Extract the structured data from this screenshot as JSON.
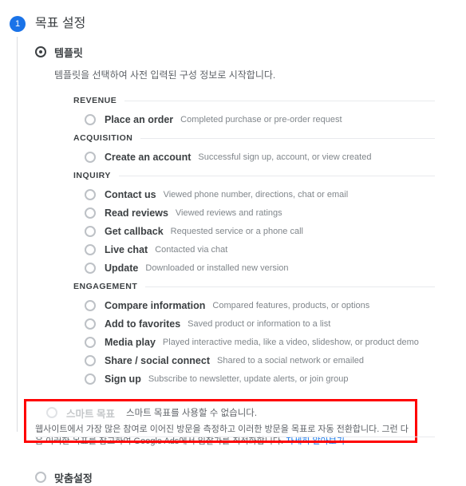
{
  "step": {
    "number": "1",
    "title": "목표 설정"
  },
  "template_option": {
    "label": "템플릿",
    "helper": "템플릿을 선택하여 사전 입력된 구성 정보로 시작합니다."
  },
  "groups": [
    {
      "name": "REVENUE",
      "options": [
        {
          "label": "Place an order",
          "description": "Completed purchase or pre-order request"
        }
      ]
    },
    {
      "name": "ACQUISITION",
      "options": [
        {
          "label": "Create an account",
          "description": "Successful sign up, account, or view created"
        }
      ]
    },
    {
      "name": "INQUIRY",
      "options": [
        {
          "label": "Contact us",
          "description": "Viewed phone number, directions, chat or email"
        },
        {
          "label": "Read reviews",
          "description": "Viewed reviews and ratings"
        },
        {
          "label": "Get callback",
          "description": "Requested service or a phone call"
        },
        {
          "label": "Live chat",
          "description": "Contacted via chat"
        },
        {
          "label": "Update",
          "description": "Downloaded or installed new version"
        }
      ]
    },
    {
      "name": "ENGAGEMENT",
      "options": [
        {
          "label": "Compare information",
          "description": "Compared features, products, or options"
        },
        {
          "label": "Add to favorites",
          "description": "Saved product or information to a list"
        },
        {
          "label": "Media play",
          "description": "Played interactive media, like a video, slideshow, or product demo"
        },
        {
          "label": "Share / social connect",
          "description": "Shared to a social network or emailed"
        },
        {
          "label": "Sign up",
          "description": "Subscribe to newsletter, update alerts, or join group"
        }
      ]
    }
  ],
  "smart_goal": {
    "label": "스마트 목표",
    "status": "스마트 목표를 사용할 수 없습니다.",
    "description": "웹사이트에서 가장 많은 참여로 이어진 방문을 측정하고 이러한 방문을 목표로 자동 전환합니다. 그런 다음 이러한 목표를 참고하여 Google Ads에서 입찰가를 최적화합니다. ",
    "link_text": "자세히 알아보기"
  },
  "custom_option": {
    "label": "맞춤설정"
  },
  "colors": {
    "accent": "#1a73e8",
    "highlight": "#ff0000",
    "text_primary": "#3c4043",
    "text_secondary": "#5f6368",
    "text_muted": "#80868b"
  }
}
